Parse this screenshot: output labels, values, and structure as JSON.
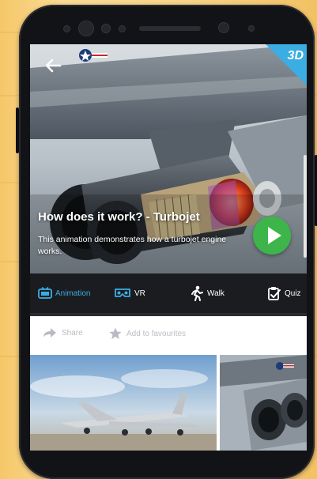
{
  "hero": {
    "title": "How does it work? - Turbojet",
    "description": "This animation demonstrates how a turbojet engine works.",
    "badge": "3D"
  },
  "tabs": [
    {
      "label": "Animation",
      "icon": "tv-icon",
      "active": true
    },
    {
      "label": "VR",
      "icon": "vr-headset-icon",
      "active": false
    },
    {
      "label": "Walk",
      "icon": "walking-person-icon",
      "active": false
    },
    {
      "label": "Quiz",
      "icon": "quiz-clipboard-icon",
      "active": false
    }
  ],
  "actions": {
    "share_label": "Share",
    "favourites_label": "Add to favourites"
  },
  "colors": {
    "accent": "#3aaee3",
    "play": "#3db54a",
    "tabbar": "#1b1c20"
  }
}
